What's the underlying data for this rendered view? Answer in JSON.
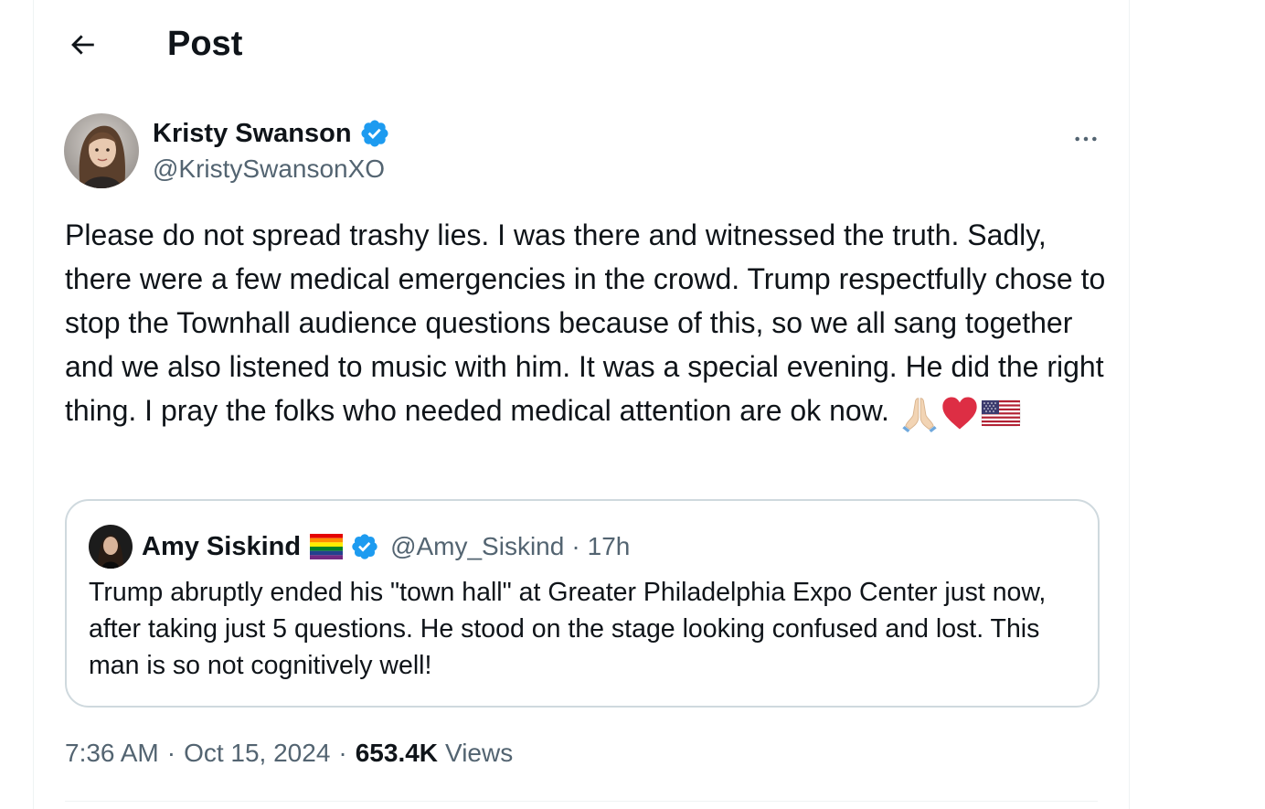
{
  "header": {
    "title": "Post",
    "back_icon": "arrow-left-icon"
  },
  "tweet": {
    "author": {
      "name": "Kristy Swanson",
      "handle": "@KristySwansonXO",
      "verified": true
    },
    "text": "Please do not spread trashy lies. I was there and witnessed the truth. Sadly, there were a few medical emergencies in the crowd. Trump respectfully chose to stop the Townhall audience questions because of this, so we all sang together and we also listened to music with him. It was a special evening. He did the right thing. I pray the folks who needed medical attention are ok now.",
    "emojis": [
      "folded-hands-icon",
      "red-heart-icon",
      "us-flag-icon"
    ],
    "quote": {
      "author": {
        "name": "Amy Siskind",
        "handle": "@Amy_Siskind",
        "verified": true,
        "flag": "rainbow-flag-icon"
      },
      "separator": "·",
      "time": "17h",
      "text": "Trump abruptly ended his \"town hall\" at Greater Philadelphia Expo Center just now, after taking just 5 questions. He stood on the stage looking confused and lost. This man is so not cognitively well!"
    },
    "meta": {
      "time": "7:36 AM",
      "separator": "·",
      "date": "Oct 15, 2024",
      "views_count": "653.4K",
      "views_label": "Views"
    }
  },
  "colors": {
    "text_primary": "#0f1419",
    "text_secondary": "#536471",
    "verified_blue": "#1d9bf0",
    "border": "#cfd9de"
  }
}
